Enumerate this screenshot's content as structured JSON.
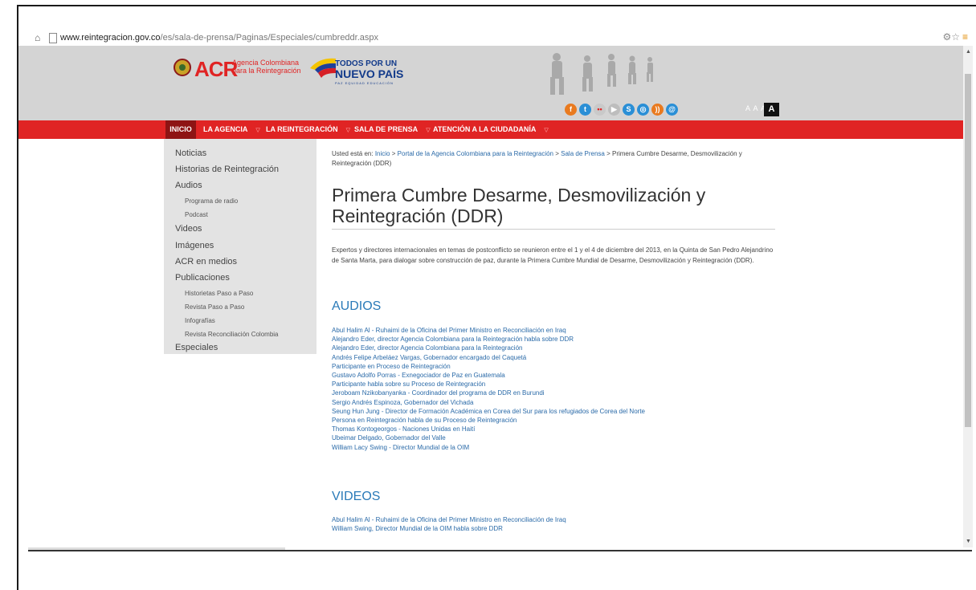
{
  "browser": {
    "url_host": "www.reintegracion.gov.co",
    "url_path": "/es/sala-de-prensa/Paginas/Especiales/cumbreddr.aspx"
  },
  "header": {
    "acr_logo_text": "ACR",
    "acr_logo_sub_line1": "Agencia Colombiana",
    "acr_logo_sub_line2": "para la Reintegración",
    "gov_logo_line1": "TODOS POR UN",
    "gov_logo_line2": "NUEVO PAÍS",
    "gov_logo_line3": "PAZ  EQUIDAD  EDUCACIÓN",
    "font_size_label": "A A A",
    "contrast_button": "A",
    "social_icons": [
      "facebook-icon",
      "twitter-icon",
      "flickr-icon",
      "youtube-icon",
      "issuu-icon",
      "instagram-icon",
      "rss-icon",
      "email-icon"
    ]
  },
  "nav": {
    "items": [
      {
        "label": "INICIO"
      },
      {
        "label": "LA AGENCIA"
      },
      {
        "label": "LA REINTEGRACIÓN"
      },
      {
        "label": "SALA DE PRENSA"
      },
      {
        "label": "ATENCIÓN A LA CIUDADANÍA"
      }
    ]
  },
  "sidebar": {
    "items": [
      {
        "label": "Noticias"
      },
      {
        "label": "Historias de Reintegración"
      },
      {
        "label": "Audios"
      },
      {
        "label": "Programa de radio"
      },
      {
        "label": "Podcast"
      },
      {
        "label": "Videos"
      },
      {
        "label": "Imágenes"
      },
      {
        "label": "ACR en medios"
      },
      {
        "label": "Publicaciones"
      },
      {
        "label": "Historietas Paso a Paso"
      },
      {
        "label": "Revista Paso a Paso"
      },
      {
        "label": "Infografías"
      },
      {
        "label": "Revista Reconciliación Colombia"
      },
      {
        "label": "Especiales"
      }
    ]
  },
  "breadcrumb": {
    "prefix": "Usted está en:",
    "items": [
      "Inicio",
      "Portal de la Agencia Colombiana para la Reintegración",
      "Sala de Prensa"
    ],
    "separator": ">",
    "current": "Primera Cumbre Desarme, Desmovilización y Reintegración (DDR)"
  },
  "main": {
    "title": "Primera Cumbre Desarme, Desmovilización y Reintegración (DDR)",
    "intro": "Expertos y directores internacionales en temas de postconflicto se reunieron entre el 1 y el 4 de diciembre del 2013, en la Quinta de San Pedro Alejandrino de Santa Marta, para dialogar sobre construcción de paz, durante la Primera Cumbre Mundial de Desarme, Desmovilización y Reintegración (DDR).",
    "audios_heading": "AUDIOS",
    "audios": [
      "Abul Halim Al - Ruhaimi de la Oficina del Primer Ministro en Reconciliación en Iraq",
      "Alejandro Eder, director Agencia Colombiana para la Reintegración habla sobre DDR",
      "Alejandro Eder, director Agencia Colombiana para la Reintegración",
      "Andrés Felipe Arbeláez Vargas, Gobernador encargado del Caquetá",
      "Participante en Proceso de Reintegración",
      "Gustavo Adolfo Porras - Exnegociador de Paz en Guatemala",
      "Participante habla sobre su Proceso de Reintegración",
      "Jeroboam Nzikobanyanka - Coordinador del programa de DDR en Burundi",
      "Sergio Andrés Espinoza, Gobernador del Vichada",
      "Seung Hun Jung - Director de  Formación Académica en Corea del Sur para los refugiados de Corea del Norte",
      "Persona en Reintegración habla de su Proceso de Reintegración",
      "Thomas Kontogeorgos - Naciones Unidas en Haití",
      "Ubeimar Delgado, Gobernador del Valle",
      "William Lacy Swing - Director Mundial de la OIM"
    ],
    "videos_heading": "VIDEOS",
    "videos": [
      "Abul Halim Al - Ruhaimi de la Oficina del Primer Ministro en Reconciliación de Iraq",
      "William Swing, Director Mundial de la OIM habla sobre DDR"
    ]
  }
}
